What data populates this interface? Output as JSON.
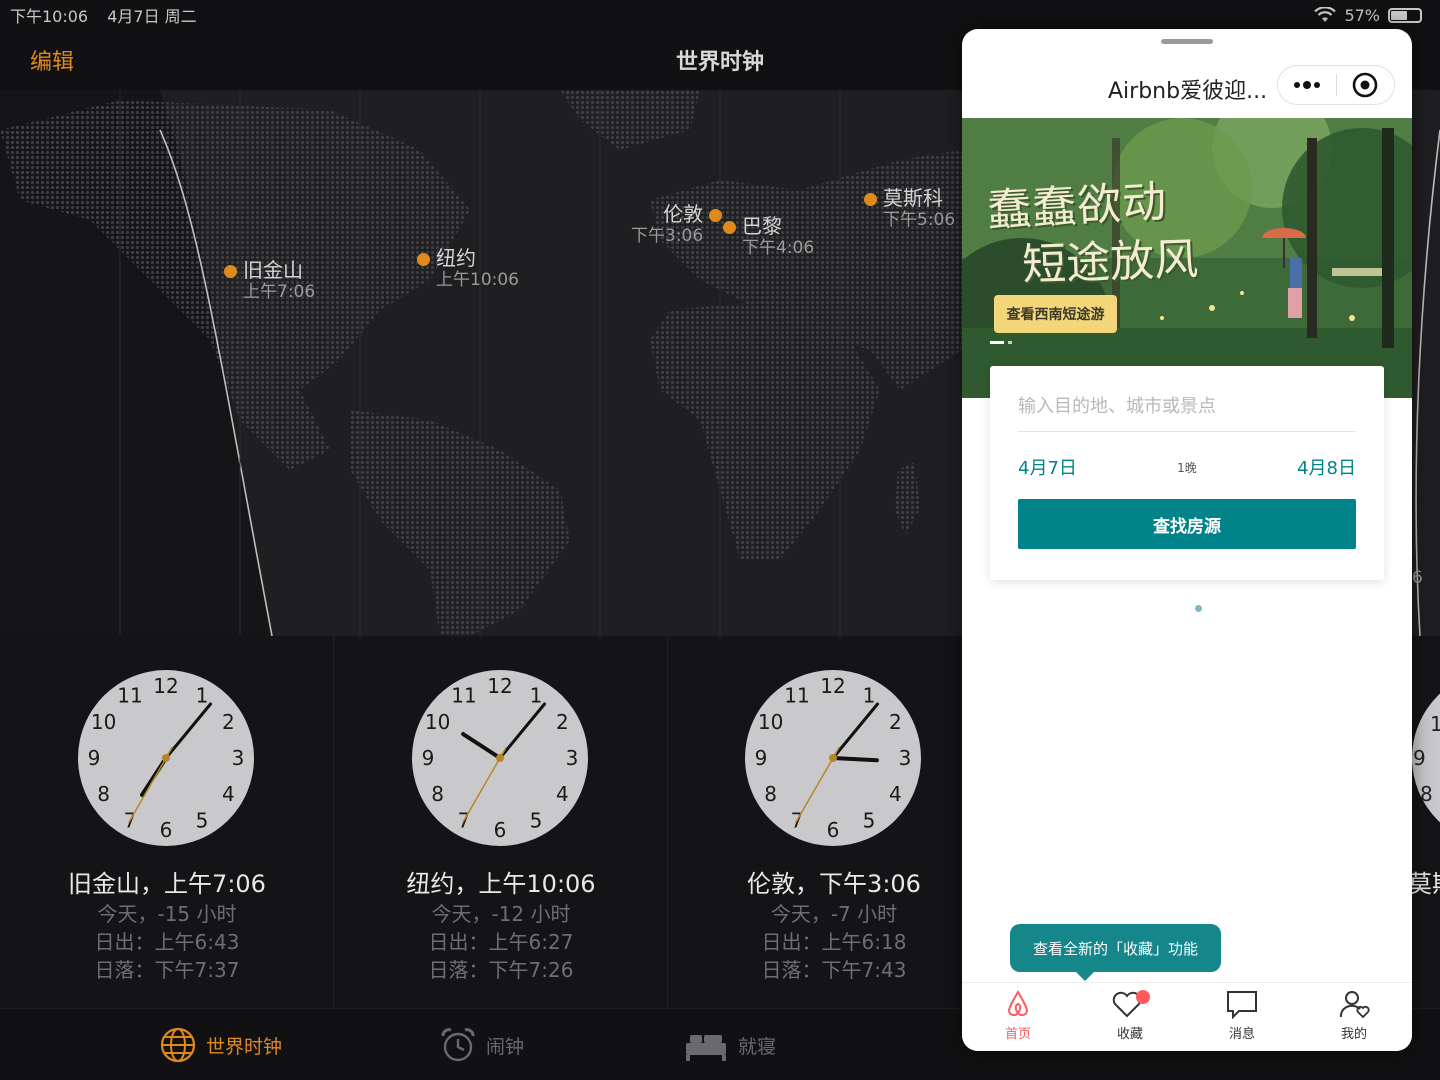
{
  "status_bar": {
    "time": "下午10:06",
    "date": "4月7日 周二",
    "battery": "57%",
    "battery_level": 0.57
  },
  "nav": {
    "edit": "编辑",
    "title": "世界时钟"
  },
  "map_cities": [
    {
      "name": "旧金山",
      "time": "上午7:06"
    },
    {
      "name": "纽约",
      "time": "上午10:06"
    },
    {
      "name": "伦敦",
      "time": "下午3:06"
    },
    {
      "name": "巴黎",
      "time": "下午4:06"
    },
    {
      "name": "莫斯科",
      "time": "下午5:06"
    }
  ],
  "clocks": [
    {
      "title": "旧金山，上午7:06",
      "day": "今天，-15 小时",
      "sunrise": "日出：上午6:43",
      "sunset": "日落：下午7:37",
      "hour": 7,
      "minute": 6,
      "second": 35
    },
    {
      "title": "纽约，上午10:06",
      "day": "今天，-12 小时",
      "sunrise": "日出：上午6:27",
      "sunset": "日落：下午7:26",
      "hour": 10,
      "minute": 6,
      "second": 35
    },
    {
      "title": "伦敦，下午3:06",
      "day": "今天，-7 小时",
      "sunrise": "日出：上午6:18",
      "sunset": "日落：下午7:43",
      "hour": 3,
      "minute": 6,
      "second": 35
    }
  ],
  "clock_numerals": [
    "12",
    "1",
    "2",
    "3",
    "4",
    "5",
    "6",
    "7",
    "8",
    "9",
    "10",
    "11"
  ],
  "edge_partial": {
    "n1": "1",
    "n2": "9",
    "n3": "8",
    "city": "莫斯",
    "minute_frag": "6"
  },
  "tabs": [
    {
      "label": "世界时钟",
      "icon": "globe-icon",
      "active": true
    },
    {
      "label": "闹钟",
      "icon": "alarm-icon"
    },
    {
      "label": "就寝",
      "icon": "bed-icon"
    }
  ],
  "mini_program": {
    "title": "Airbnb爱彼迎...",
    "banner": {
      "line1": "蠢蠢欲动",
      "line2": "短途放风",
      "button": "查看西南短途游"
    },
    "search": {
      "placeholder": "输入目的地、城市或景点",
      "checkin": "4月7日",
      "nights": "1晚",
      "checkout": "4月8日",
      "button": "查找房源"
    },
    "tooltip": "查看全新的「收藏」功能",
    "tabs": [
      {
        "label": "首页",
        "icon": "airbnb-logo-icon",
        "active": true
      },
      {
        "label": "收藏",
        "icon": "heart-icon"
      },
      {
        "label": "消息",
        "icon": "message-icon"
      },
      {
        "label": "我的",
        "icon": "profile-icon"
      }
    ]
  },
  "colors": {
    "accent": "#e08a1e",
    "airbnb_teal": "#008489",
    "airbnb_red": "#ff5a5f"
  }
}
